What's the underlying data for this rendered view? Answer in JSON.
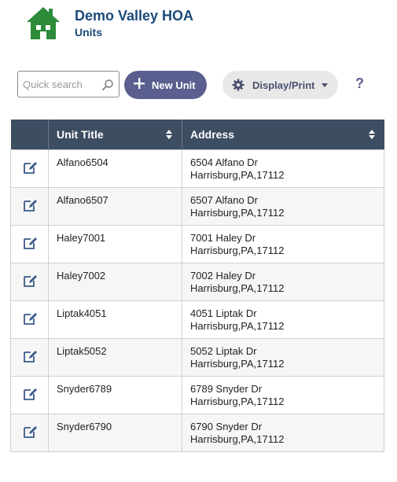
{
  "header": {
    "org_name": "Demo Valley HOA",
    "page_title": "Units",
    "logo_icon": "house-icon",
    "brand_color": "#2e8b3a"
  },
  "toolbar": {
    "search_placeholder": "Quick search",
    "search_value": "",
    "new_unit_label": "New Unit",
    "display_label": "Display/Print",
    "help_label": "?"
  },
  "table": {
    "headers": [
      "",
      "Unit Title",
      "Address"
    ],
    "rows": [
      {
        "title": "Alfano6504",
        "street": "6504 Alfano Dr",
        "city": "Harrisburg,PA,17112"
      },
      {
        "title": "Alfano6507",
        "street": "6507 Alfano Dr",
        "city": "Harrisburg,PA,17112"
      },
      {
        "title": "Haley7001",
        "street": "7001 Haley Dr",
        "city": "Harrisburg,PA,17112"
      },
      {
        "title": "Haley7002",
        "street": "7002 Haley Dr",
        "city": "Harrisburg,PA,17112"
      },
      {
        "title": "Liptak4051",
        "street": "4051 Liptak Dr",
        "city": "Harrisburg,PA,17112"
      },
      {
        "title": "Liptak5052",
        "street": "5052 Liptak Dr",
        "city": "Harrisburg,PA,17112"
      },
      {
        "title": "Snyder6789",
        "street": "6789 Snyder Dr",
        "city": "Harrisburg,PA,17112"
      },
      {
        "title": "Snyder6790",
        "street": "6790 Snyder Dr",
        "city": "Harrisburg,PA,17112"
      }
    ]
  },
  "colors": {
    "header_bg": "#3d4d62",
    "primary_button": "#5a5f8f",
    "title_text": "#1a4a7a"
  }
}
